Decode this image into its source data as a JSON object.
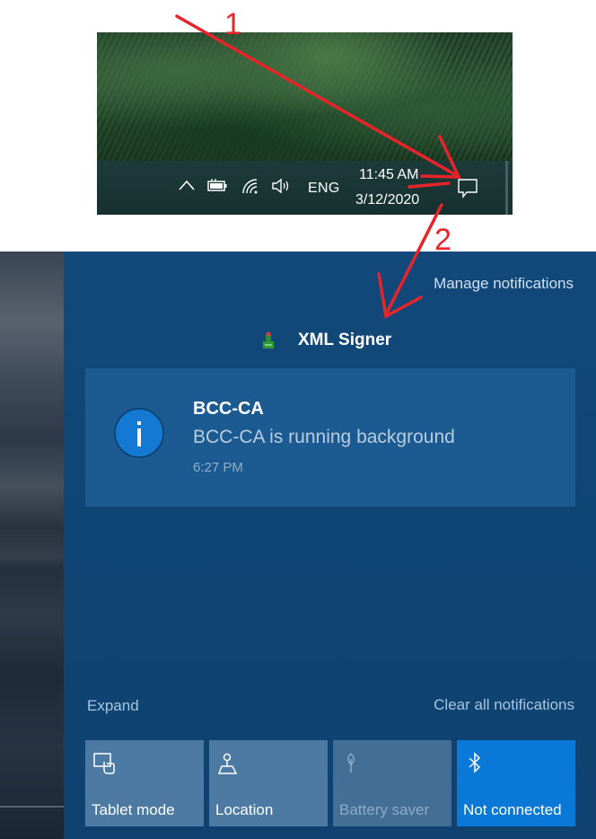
{
  "taskbar": {
    "language": "ENG",
    "time": "11:45 AM",
    "date": "3/12/2020",
    "icons": [
      "chevron-up-icon",
      "battery-icon",
      "wifi-icon",
      "volume-icon",
      "action-center-icon"
    ]
  },
  "annotations": {
    "step1": "1",
    "step2": "2",
    "color": "#e8242b"
  },
  "action_center": {
    "manage_label": "Manage notifications",
    "group": {
      "app_name": "XML Signer",
      "icon": "xml-signer-app-icon"
    },
    "notification": {
      "title": "BCC-CA",
      "body": "BCC-CA is running background",
      "time": "6:27 PM",
      "icon": "info-icon"
    },
    "expand_label": "Expand",
    "clear_all_label": "Clear all notifications",
    "quick_actions": [
      {
        "label": "Tablet mode",
        "icon": "tablet-mode-icon",
        "state": "off"
      },
      {
        "label": "Location",
        "icon": "location-icon",
        "state": "off"
      },
      {
        "label": "Battery saver",
        "icon": "battery-saver-icon",
        "state": "disabled"
      },
      {
        "label": "Not connected",
        "icon": "bluetooth-icon",
        "state": "on"
      }
    ],
    "colors": {
      "panel": "#0f4574",
      "toast": "#1c5b91",
      "tile": "#4c7aa3",
      "tile_active": "#0a78d7"
    }
  }
}
